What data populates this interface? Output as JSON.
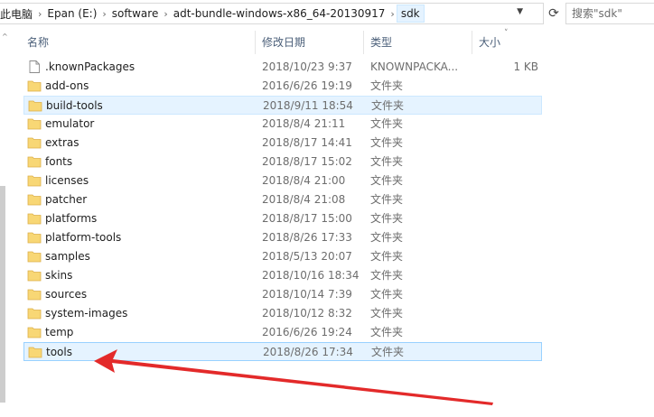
{
  "address_bar": {
    "crumbs": [
      "此电脑",
      "Epan (E:)",
      "software",
      "adt-bundle-windows-x86_64-20130917",
      "sdk"
    ]
  },
  "search": {
    "placeholder": "搜索\"sdk\""
  },
  "columns": {
    "name": "名称",
    "date": "修改日期",
    "type": "类型",
    "size": "大小"
  },
  "files": [
    {
      "name": ".knownPackages",
      "date": "2018/10/23 9:37",
      "type": "KNOWNPACKA...",
      "size": "1 KB",
      "icon": "file-icon"
    },
    {
      "name": "add-ons",
      "date": "2016/6/26 19:19",
      "type": "文件夹",
      "size": "",
      "icon": "folder-icon"
    },
    {
      "name": "build-tools",
      "date": "2018/9/11 18:54",
      "type": "文件夹",
      "size": "",
      "icon": "folder-icon"
    },
    {
      "name": "emulator",
      "date": "2018/8/4 21:11",
      "type": "文件夹",
      "size": "",
      "icon": "folder-icon"
    },
    {
      "name": "extras",
      "date": "2018/8/17 14:41",
      "type": "文件夹",
      "size": "",
      "icon": "folder-icon"
    },
    {
      "name": "fonts",
      "date": "2018/8/17 15:02",
      "type": "文件夹",
      "size": "",
      "icon": "folder-icon"
    },
    {
      "name": "licenses",
      "date": "2018/8/4 21:00",
      "type": "文件夹",
      "size": "",
      "icon": "folder-icon"
    },
    {
      "name": "patcher",
      "date": "2018/8/4 21:08",
      "type": "文件夹",
      "size": "",
      "icon": "folder-icon"
    },
    {
      "name": "platforms",
      "date": "2018/8/17 15:00",
      "type": "文件夹",
      "size": "",
      "icon": "folder-icon"
    },
    {
      "name": "platform-tools",
      "date": "2018/8/26 17:33",
      "type": "文件夹",
      "size": "",
      "icon": "folder-icon"
    },
    {
      "name": "samples",
      "date": "2018/5/13 20:07",
      "type": "文件夹",
      "size": "",
      "icon": "folder-icon"
    },
    {
      "name": "skins",
      "date": "2018/10/16 18:34",
      "type": "文件夹",
      "size": "",
      "icon": "folder-icon"
    },
    {
      "name": "sources",
      "date": "2018/10/14 7:39",
      "type": "文件夹",
      "size": "",
      "icon": "folder-icon"
    },
    {
      "name": "system-images",
      "date": "2018/10/12 8:32",
      "type": "文件夹",
      "size": "",
      "icon": "folder-icon"
    },
    {
      "name": "temp",
      "date": "2016/6/26 19:24",
      "type": "文件夹",
      "size": "",
      "icon": "folder-icon"
    },
    {
      "name": "tools",
      "date": "2018/8/26 17:34",
      "type": "文件夹",
      "size": "",
      "icon": "folder-icon"
    }
  ],
  "states": {
    "hover_row": "build-tools",
    "selected_row": "tools"
  },
  "colors": {
    "selection": "#e5f3ff",
    "selection_border": "#99d1ff",
    "folder": "#f8d775",
    "annotation_arrow": "#e32a2a",
    "header_text": "#4c607a"
  }
}
